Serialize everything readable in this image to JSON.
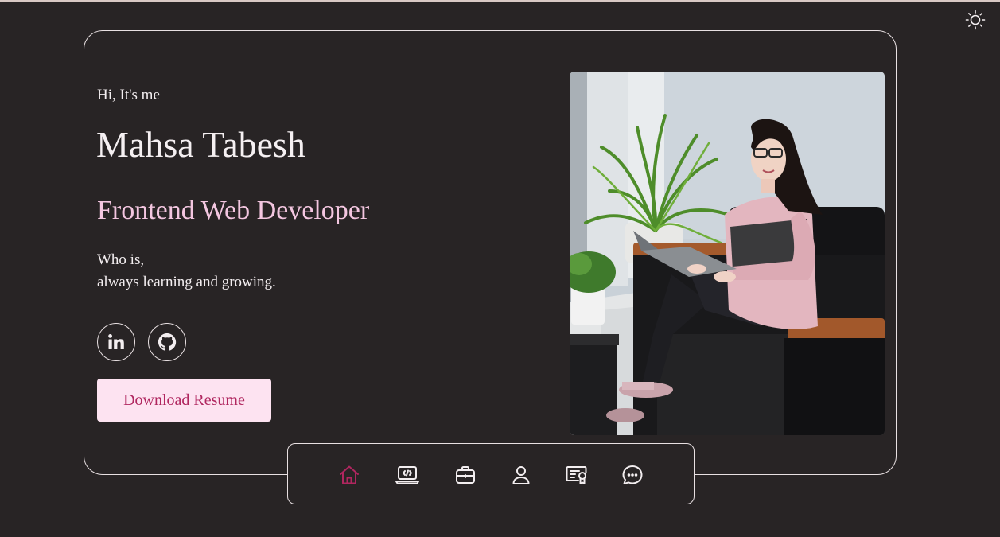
{
  "hero": {
    "greeting": "Hi, It's me",
    "name": "Mahsa Tabesh",
    "role": "Frontend Web Developer",
    "tagline_line1": "Who is,",
    "tagline_line2": "always learning and growing.",
    "download_label": "Download Resume"
  },
  "social": [
    {
      "icon": "linkedin-icon"
    },
    {
      "icon": "github-icon"
    }
  ],
  "nav": {
    "items": [
      {
        "icon": "home-icon",
        "active": true
      },
      {
        "icon": "laptop-code-icon",
        "active": false
      },
      {
        "icon": "briefcase-icon",
        "active": false
      },
      {
        "icon": "user-icon",
        "active": false
      },
      {
        "icon": "certificate-icon",
        "active": false
      },
      {
        "icon": "chat-icon",
        "active": false
      }
    ]
  },
  "colors": {
    "background": "#282425",
    "accent": "#b0265f",
    "role_text": "#f3c6e0",
    "button_bg": "#fde3f1",
    "icon_light": "#f3eef0"
  }
}
